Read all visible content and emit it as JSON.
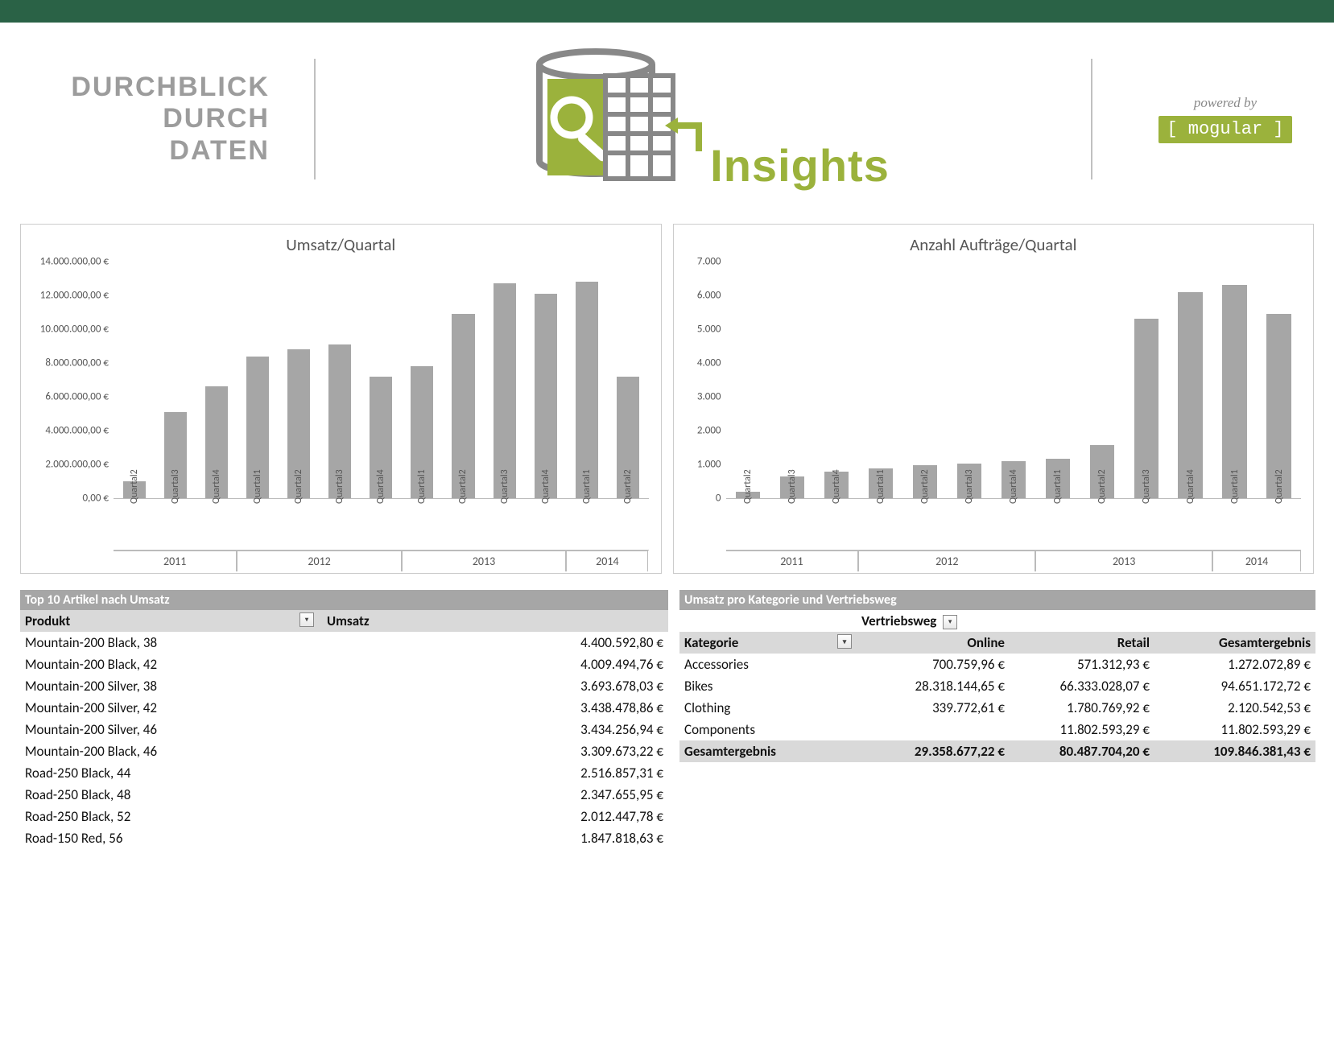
{
  "accent": "#9bb23c",
  "header": {
    "slogan_l1": "DURCHBLICK",
    "slogan_l2": "DURCH",
    "slogan_l3": "DATEN",
    "brand_word": "Insights",
    "powered_by": "powered by",
    "brand": "[ mogular ]"
  },
  "chart_data": [
    {
      "id": "umsatz",
      "type": "bar",
      "title": "Umsatz/Quartal",
      "yformat": "euro",
      "ylim": [
        0,
        14000000
      ],
      "yticks": [
        0,
        2000000,
        4000000,
        6000000,
        8000000,
        10000000,
        12000000,
        14000000
      ],
      "categories": [
        "Quartal2",
        "Quartal3",
        "Quartal4",
        "Quartal1",
        "Quartal2",
        "Quartal3",
        "Quartal4",
        "Quartal1",
        "Quartal2",
        "Quartal3",
        "Quartal4",
        "Quartal1",
        "Quartal2"
      ],
      "values": [
        1000000,
        5100000,
        6600000,
        8400000,
        8800000,
        9100000,
        7200000,
        7800000,
        10900000,
        12700000,
        12100000,
        12800000,
        7200000
      ],
      "year_groups": [
        {
          "label": "2011",
          "span": [
            0,
            3
          ]
        },
        {
          "label": "2012",
          "span": [
            3,
            7
          ]
        },
        {
          "label": "2013",
          "span": [
            7,
            11
          ]
        },
        {
          "label": "2014",
          "span": [
            11,
            13
          ]
        }
      ]
    },
    {
      "id": "orders",
      "type": "bar",
      "title": "Anzahl Aufträge/Quartal",
      "yformat": "int",
      "ylim": [
        0,
        7000
      ],
      "yticks": [
        0,
        1000,
        2000,
        3000,
        4000,
        5000,
        6000,
        7000
      ],
      "categories": [
        "Quartal2",
        "Quartal3",
        "Quartal4",
        "Quartal1",
        "Quartal2",
        "Quartal3",
        "Quartal4",
        "Quartal1",
        "Quartal2",
        "Quartal3",
        "Quartal4",
        "Quartal1",
        "Quartal2"
      ],
      "values": [
        180,
        650,
        780,
        880,
        970,
        1020,
        1100,
        1170,
        1580,
        5300,
        6100,
        6300,
        5450
      ],
      "year_groups": [
        {
          "label": "2011",
          "span": [
            0,
            3
          ]
        },
        {
          "label": "2012",
          "span": [
            3,
            7
          ]
        },
        {
          "label": "2013",
          "span": [
            7,
            11
          ]
        },
        {
          "label": "2014",
          "span": [
            11,
            13
          ]
        }
      ]
    }
  ],
  "top10": {
    "section_title": "Top 10 Artikel nach Umsatz",
    "col_product": "Produkt",
    "col_revenue": "Umsatz",
    "rows": [
      {
        "p": "Mountain-200 Black, 38",
        "v": "4.400.592,80 €"
      },
      {
        "p": "Mountain-200 Black, 42",
        "v": "4.009.494,76 €"
      },
      {
        "p": "Mountain-200 Silver, 38",
        "v": "3.693.678,03 €"
      },
      {
        "p": "Mountain-200 Silver, 42",
        "v": "3.438.478,86 €"
      },
      {
        "p": "Mountain-200 Silver, 46",
        "v": "3.434.256,94 €"
      },
      {
        "p": "Mountain-200 Black, 46",
        "v": "3.309.673,22 €"
      },
      {
        "p": "Road-250 Black, 44",
        "v": "2.516.857,31 €"
      },
      {
        "p": "Road-250 Black, 48",
        "v": "2.347.655,95 €"
      },
      {
        "p": "Road-250 Black, 52",
        "v": "2.012.447,78 €"
      },
      {
        "p": "Road-150 Red, 56",
        "v": "1.847.818,63 €"
      }
    ]
  },
  "pivot": {
    "section_title": "Umsatz pro Kategorie und Vertriebsweg",
    "col_channel": "Vertriebsweg",
    "col_category": "Kategorie",
    "col_online": "Online",
    "col_retail": "Retail",
    "col_total": "Gesamtergebnis",
    "rows": [
      {
        "c": "Accessories",
        "o": "700.759,96 €",
        "r": "571.312,93 €",
        "t": "1.272.072,89 €"
      },
      {
        "c": "Bikes",
        "o": "28.318.144,65 €",
        "r": "66.333.028,07 €",
        "t": "94.651.172,72 €"
      },
      {
        "c": "Clothing",
        "o": "339.772,61 €",
        "r": "1.780.769,92 €",
        "t": "2.120.542,53 €"
      },
      {
        "c": "Components",
        "o": "",
        "r": "11.802.593,29 €",
        "t": "11.802.593,29 €"
      }
    ],
    "total": {
      "c": "Gesamtergebnis",
      "o": "29.358.677,22 €",
      "r": "80.487.704,20 €",
      "t": "109.846.381,43 €"
    }
  }
}
